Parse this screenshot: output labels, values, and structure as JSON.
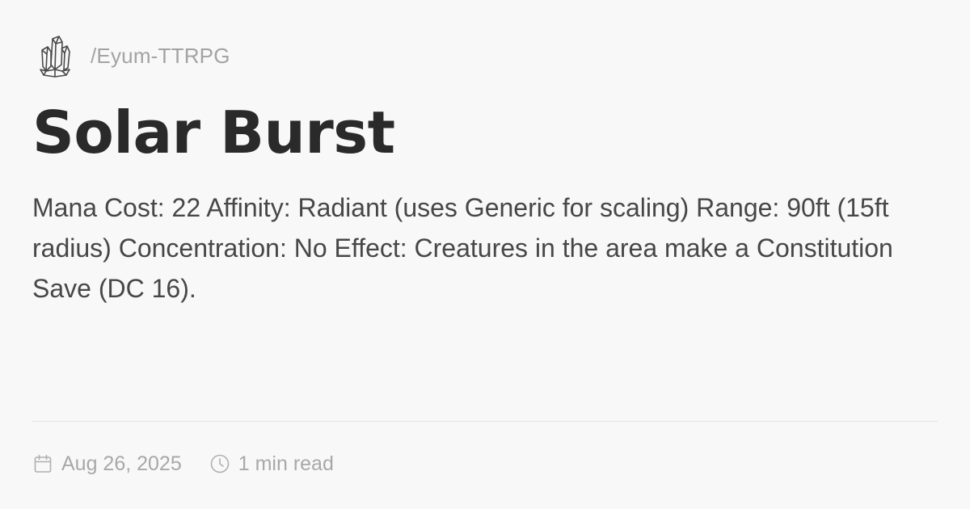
{
  "header": {
    "logo_icon": "crystal-cluster-icon",
    "breadcrumb": "/Eyum-TTRPG"
  },
  "post": {
    "title": "Solar Burst",
    "description": "Mana Cost: 22 Affinity: Radiant (uses Generic for scaling) Range: 90ft (15ft radius) Concentration: No Effect: Creatures in the area make a Constitution Save (DC 16)."
  },
  "meta": {
    "date_icon": "calendar-icon",
    "date": "Aug 26, 2025",
    "read_time_icon": "clock-icon",
    "read_time": "1 min read"
  },
  "colors": {
    "background": "#f9f8f8",
    "title": "#2a2a2a",
    "body_text": "#474747",
    "muted_text": "#a8a8a8",
    "divider": "#e4e2e2"
  }
}
